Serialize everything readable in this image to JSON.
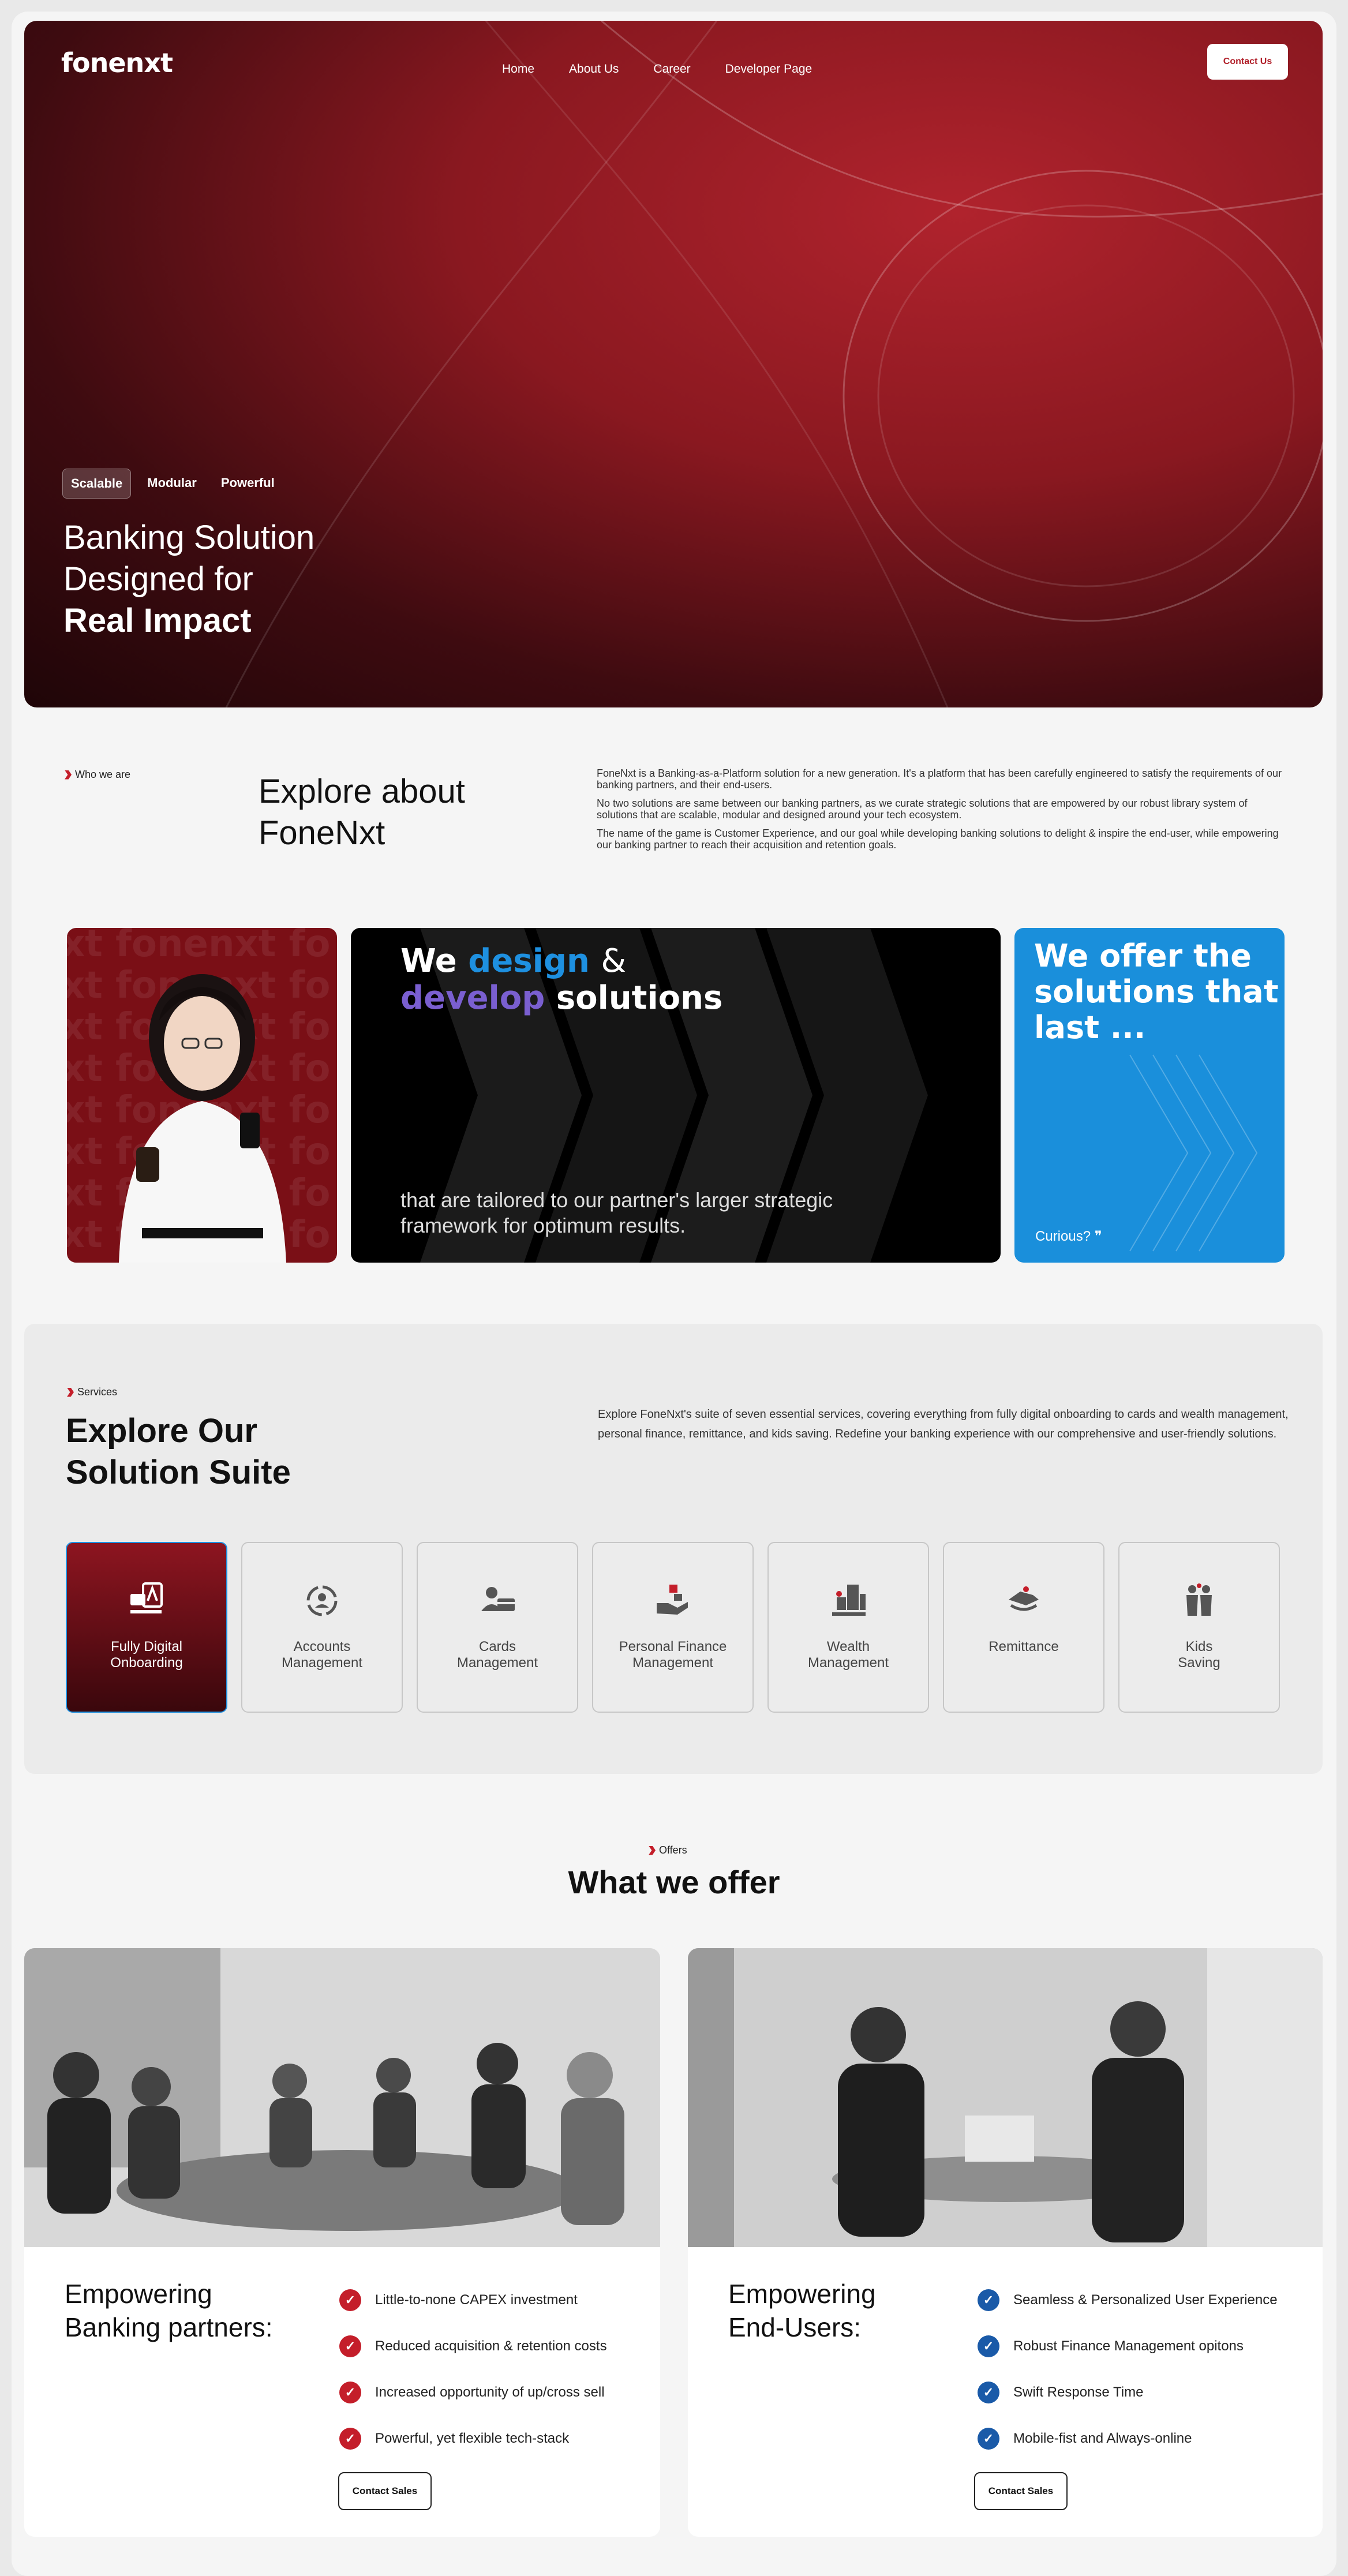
{
  "header": {
    "logo": "fonenxt",
    "nav": [
      "Home",
      "About Us",
      "Career",
      "Developer Page"
    ],
    "contact_button": "Contact Us"
  },
  "hero": {
    "tags": [
      "Scalable",
      "Modular",
      "Powerful"
    ],
    "heading_line1": "Banking Solution",
    "heading_line2": "Designed for",
    "heading_line3": "Real Impact"
  },
  "about": {
    "crumb": "Who we are",
    "heading_line1": "Explore about",
    "heading_line2": "FoneNxt",
    "paragraphs": [
      "FoneNxt is a Banking-as-a-Platform solution for a new generation. It's a platform that has been carefully engineered to satisfy the requirements of our banking partners, and their end-users.",
      "No two solutions are same between our banking partners, as we curate strategic solutions that are empowered by our robust library system of solutions that are scalable, modular and designed around your tech ecosystem.",
      "The name of the game is Customer Experience, and our goal while developing banking solutions to delight & inspire the end-user, while empowering our banking partner to reach their acquisition and retention goals."
    ]
  },
  "cards": {
    "watermark": "xt fonenxt fo",
    "design_we": "We",
    "design_word": "design",
    "design_amp": "&",
    "develop_word": "develop",
    "solutions_word": "solutions",
    "design_sub": "that are tailored to our partner's larger strategic framework for optimum results.",
    "offer_heading": "We offer the solutions that last ...",
    "curious": "Curious?"
  },
  "services": {
    "crumb": "Services",
    "heading_line1": "Explore Our",
    "heading_line2": "Solution Suite",
    "description": "Explore FoneNxt's suite of seven essential services, covering everything from fully digital onboarding to cards and wealth management, personal finance, remittance, and kids saving. Redefine your banking experience with our comprehensive and user-friendly solutions.",
    "tiles": [
      {
        "label": "Fully Digital\nOnboarding",
        "icon": "onboarding-icon"
      },
      {
        "label": "Accounts\nManagement",
        "icon": "accounts-icon"
      },
      {
        "label": "Cards\nManagement",
        "icon": "cards-icon"
      },
      {
        "label": "Personal Finance\nManagement",
        "icon": "personal-finance-icon"
      },
      {
        "label": "Wealth\nManagement",
        "icon": "wealth-icon"
      },
      {
        "label": "Remittance",
        "icon": "remittance-icon"
      },
      {
        "label": "Kids\nSaving",
        "icon": "kids-saving-icon"
      }
    ]
  },
  "offers": {
    "crumb": "Offers",
    "heading": "What we offer",
    "partners": {
      "heading_line1": "Empowering",
      "heading_line2": "Banking partners:",
      "items": [
        "Little-to-none CAPEX investment",
        "Reduced acquisition & retention costs",
        "Increased opportunity of up/cross sell",
        "Powerful, yet flexible tech-stack"
      ],
      "button": "Contact Sales",
      "check_color": "#c41e2a"
    },
    "users": {
      "heading_line1": "Empowering",
      "heading_line2": "End-Users:",
      "items": [
        "Seamless & Personalized User Experience",
        "Robust Finance Management opitons",
        "Swift Response Time",
        "Mobile-fist and Always-online"
      ],
      "button": "Contact Sales",
      "check_color": "#1a5aa8"
    }
  },
  "colors": {
    "brand_red": "#b1202a",
    "accent_blue": "#1a8fdb"
  }
}
